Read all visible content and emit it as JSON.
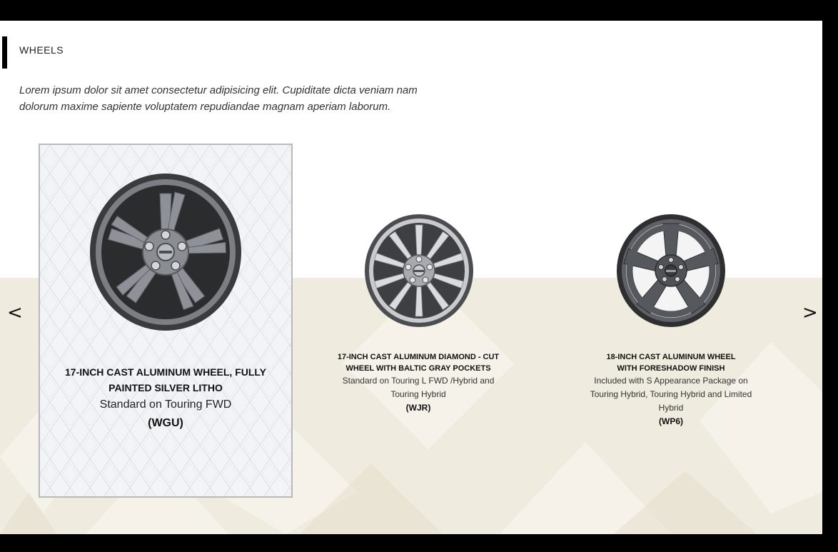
{
  "section": {
    "title": "WHEELS",
    "description": "Lorem ipsum dolor sit amet consectetur adipisicing elit. Cupiditate dicta veniam nam dolorum maxime sapiente voluptatem repudiandae magnam aperiam laborum."
  },
  "carousel": {
    "prev_label": "<",
    "next_label": ">",
    "items": [
      {
        "name": "17-INCH CAST ALUMINUM WHEEL, FULLY PAINTED SILVER LITHO",
        "description": "Standard on Touring FWD",
        "code": "(WGU)",
        "selected": true
      },
      {
        "name": "17-INCH CAST ALUMINUM DIAMOND - CUT WHEEL WITH BALTIC GRAY POCKETS",
        "description": "Standard on Touring L FWD /Hybrid and Touring Hybrid",
        "code": "(WJR)",
        "selected": false
      },
      {
        "name": "18-INCH CAST ALUMINUM WHEEL WITH FORESHADOW FINISH",
        "description": "Included with S Appearance Package on Touring Hybrid, Touring Hybrid and Limited Hybrid",
        "code": "(WP6)",
        "selected": false
      }
    ]
  },
  "colors": {
    "frame": "#000000",
    "page": "#ffffff",
    "band": "#efebdf",
    "selected_card": "#f2f4f7"
  }
}
